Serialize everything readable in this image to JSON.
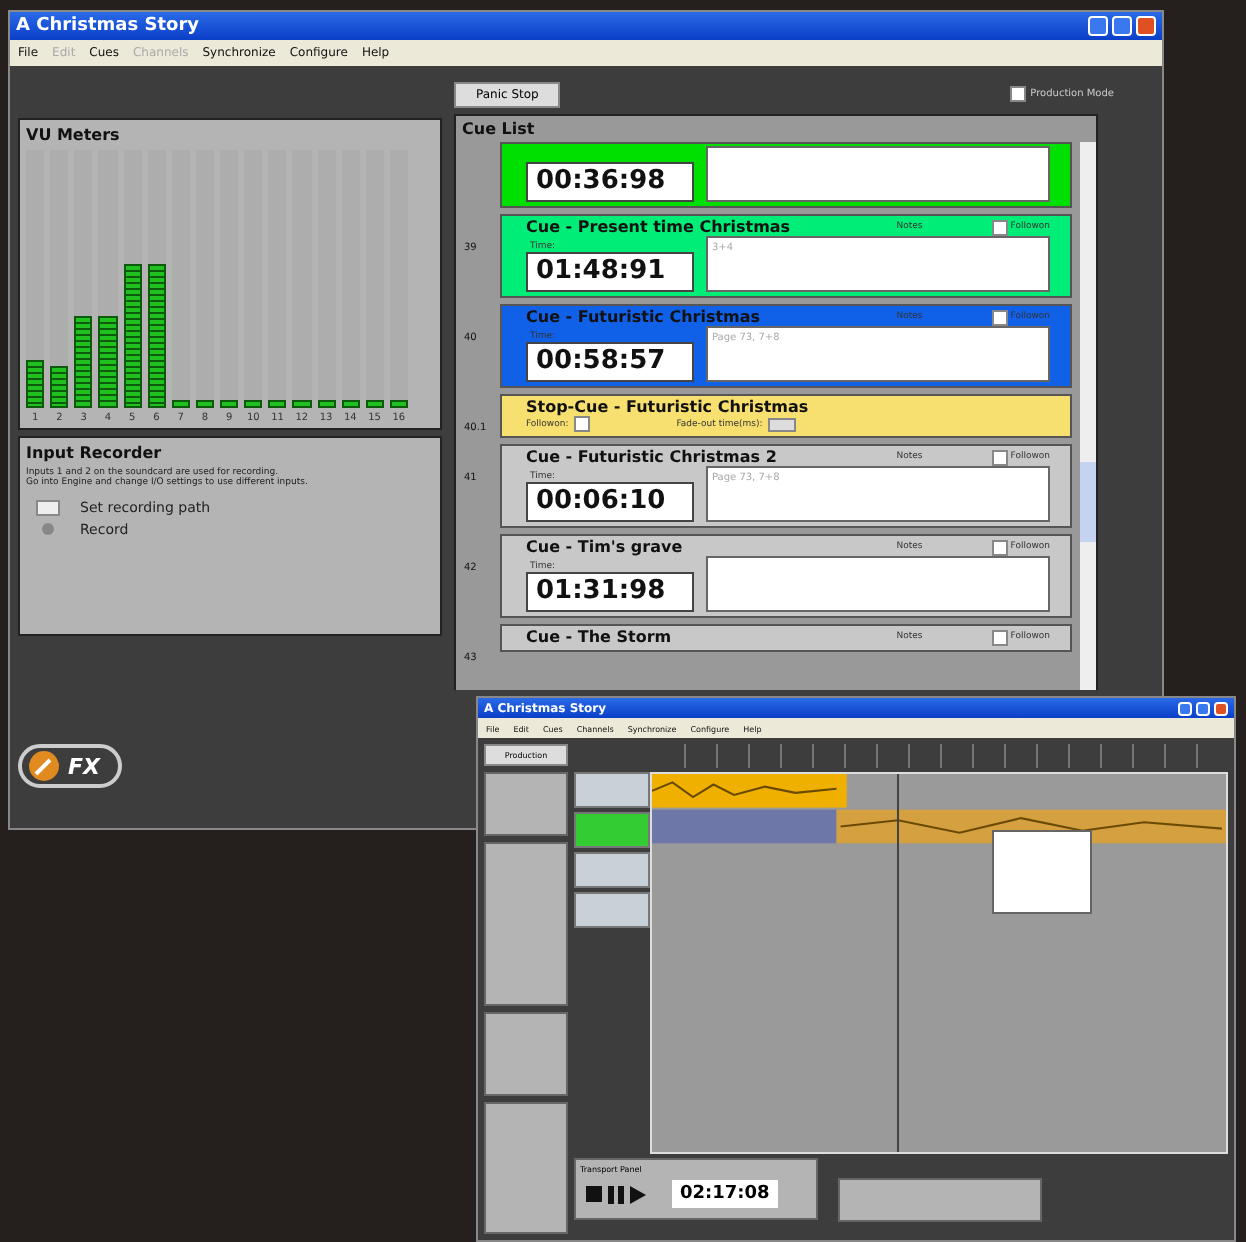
{
  "main_window": {
    "title": "A Christmas Story",
    "menu": [
      {
        "label": "File",
        "disabled": false
      },
      {
        "label": "Edit",
        "disabled": true
      },
      {
        "label": "Cues",
        "disabled": false
      },
      {
        "label": "Channels",
        "disabled": true
      },
      {
        "label": "Synchronize",
        "disabled": false
      },
      {
        "label": "Configure",
        "disabled": false
      },
      {
        "label": "Help",
        "disabled": false
      }
    ],
    "panic_button": "Panic Stop",
    "production_mode": {
      "label": "Production Mode",
      "checked": false
    },
    "vu_meters": {
      "title": "VU Meters",
      "meters": [
        {
          "label": "1",
          "level": 0.19
        },
        {
          "label": "2",
          "level": 0.16
        },
        {
          "label": "3",
          "level": 0.36
        },
        {
          "label": "4",
          "level": 0.36
        },
        {
          "label": "5",
          "level": 0.56
        },
        {
          "label": "6",
          "level": 0.56
        },
        {
          "label": "7",
          "level": 0.03
        },
        {
          "label": "8",
          "level": 0.03
        },
        {
          "label": "9",
          "level": 0.03
        },
        {
          "label": "10",
          "level": 0.03
        },
        {
          "label": "11",
          "level": 0.03
        },
        {
          "label": "12",
          "level": 0.03
        },
        {
          "label": "13",
          "level": 0.03
        },
        {
          "label": "14",
          "level": 0.03
        },
        {
          "label": "15",
          "level": 0.03
        },
        {
          "label": "16",
          "level": 0.03
        }
      ]
    },
    "input_recorder": {
      "title": "Input Recorder",
      "description": [
        "Inputs 1 and 2 on the soundcard are used for recording.",
        "Go into Engine and change I/O settings to use different inputs."
      ],
      "actions": [
        {
          "kind": "folder",
          "label": "Set recording path"
        },
        {
          "kind": "record",
          "label": "Record"
        }
      ]
    },
    "cue_list": {
      "title": "Cue List",
      "cues": [
        {
          "kind": "cue",
          "color": "#00e000",
          "time": "00:36:98"
        },
        {
          "kind": "cue",
          "number": "39",
          "title": "Cue - Present time Christmas",
          "color": "#00ee77",
          "time_label": "Time:",
          "time": "01:48:91",
          "notes_label": "Notes",
          "notes": "3+4",
          "followon": {
            "label": "Followon",
            "checked": false
          }
        },
        {
          "kind": "cue",
          "number": "40",
          "title": "Cue - Futuristic Christmas",
          "color": "#1060e8",
          "time_label": "Time:",
          "time": "00:58:57",
          "notes_label": "Notes",
          "notes": "Page 73, 7+8",
          "followon": {
            "label": "Followon",
            "checked": false
          }
        },
        {
          "kind": "stop",
          "number": "40.1",
          "title": "Stop-Cue - Futuristic Christmas",
          "color": "#f8e070",
          "followon_label": "Followon:",
          "fade_label": "Fade-out time(ms):"
        },
        {
          "kind": "cue",
          "number": "41",
          "title": "Cue - Futuristic Christmas 2",
          "color": "#c8c8c8",
          "time_label": "Time:",
          "time": "00:06:10",
          "notes_label": "Notes",
          "notes": "Page 73, 7+8",
          "followon": {
            "label": "Followon",
            "checked": false
          }
        },
        {
          "kind": "cue",
          "number": "42",
          "title": "Cue - Tim's grave",
          "color": "#c8c8c8",
          "time_label": "Time:",
          "time": "01:31:98",
          "notes_label": "Notes",
          "followon": {
            "label": "Followon",
            "checked": false
          }
        },
        {
          "kind": "cue",
          "number": "43",
          "title": "Cue - The Storm",
          "color": "#c8c8c8",
          "notes_label": "Notes",
          "followon": {
            "label": "Followon",
            "checked": false
          }
        }
      ]
    },
    "logo": "FX"
  },
  "editor_window": {
    "title": "A Christmas Story",
    "menu": [
      "File",
      "Edit",
      "Cues",
      "Channels",
      "Synchronize",
      "Configure",
      "Help"
    ],
    "production_button": "Production",
    "transport": {
      "title": "Transport Panel",
      "time": "02:17:08"
    }
  }
}
